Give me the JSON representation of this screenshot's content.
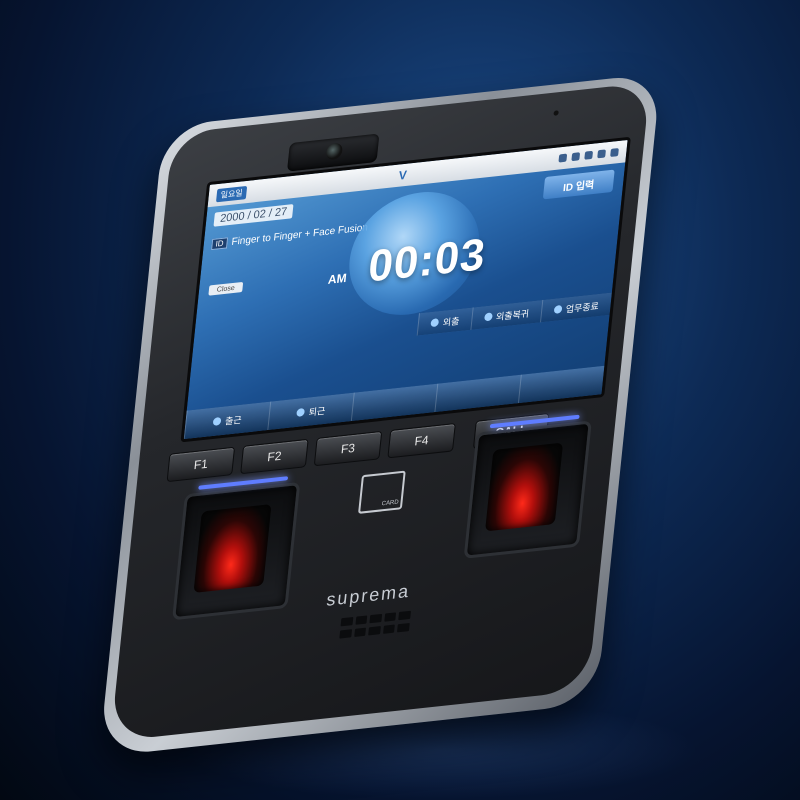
{
  "screen": {
    "date": "2000 / 02 / 27",
    "status_tag": "일요일",
    "id_button": "ID 입력",
    "mode_tag": "ID",
    "auth_mode": "Finger to Finger + Face Fusion",
    "small_button": "Close",
    "ampm": "AM",
    "time": "00:03",
    "side_functions": [
      "외출",
      "외출복귀",
      "업무종료"
    ],
    "bottom_functions": [
      "출근",
      "퇴근"
    ]
  },
  "keys": [
    "F1",
    "F2",
    "F3",
    "F4",
    "CALL"
  ],
  "card_label": "CARD",
  "brand": "suprema",
  "colors": {
    "background": "#0d2a55",
    "screen": "#2e6fb4",
    "sensor_glow": "#ff2a1a",
    "led": "#5f7dff"
  }
}
